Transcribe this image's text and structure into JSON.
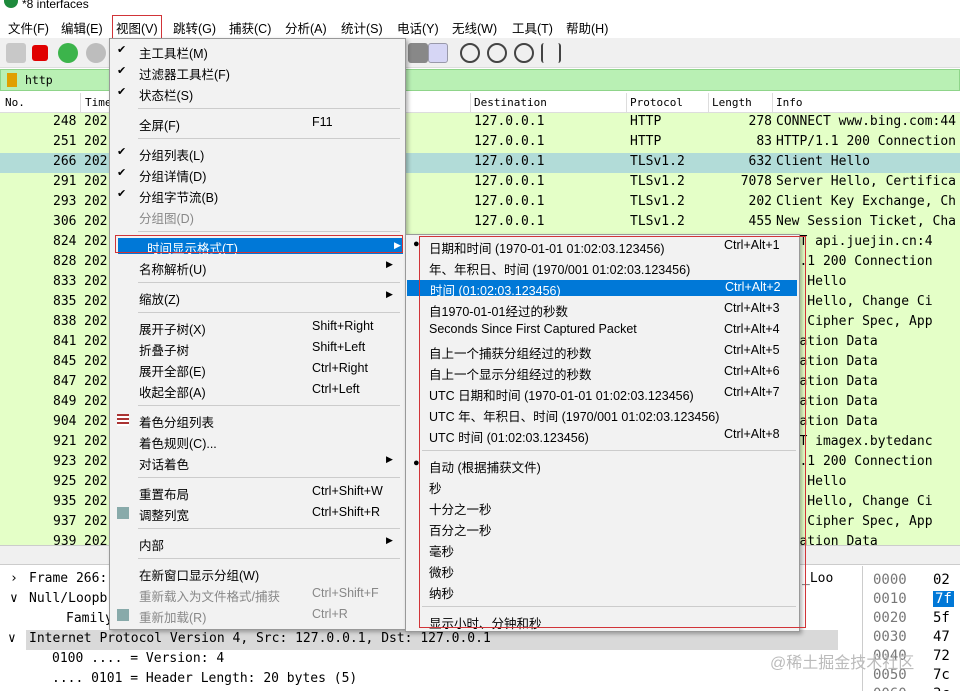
{
  "window": {
    "title": "*8 interfaces"
  },
  "menubar": [
    "文件(F)",
    "编辑(E)",
    "视图(V)",
    "跳转(G)",
    "捕获(C)",
    "分析(A)",
    "统计(S)",
    "电话(Y)",
    "无线(W)",
    "工具(T)",
    "帮助(H)"
  ],
  "filter": {
    "value": "http"
  },
  "columns": [
    "No.",
    "Time",
    "Destination",
    "Protocol",
    "Length",
    "Info"
  ],
  "packets": [
    {
      "no": "248",
      "time": "202",
      "dst": "127.0.0.1",
      "proto": "HTTP",
      "len": "278",
      "info": "CONNECT www.bing.com:44"
    },
    {
      "no": "251",
      "time": "202",
      "dst": "127.0.0.1",
      "proto": "HTTP",
      "len": "83",
      "info": "HTTP/1.1 200 Connection"
    },
    {
      "no": "266",
      "time": "202",
      "dst": "127.0.0.1",
      "proto": "TLSv1.2",
      "len": "632",
      "info": "Client Hello"
    },
    {
      "no": "291",
      "time": "202",
      "dst": "127.0.0.1",
      "proto": "TLSv1.2",
      "len": "7078",
      "info": "Server Hello, Certifica"
    },
    {
      "no": "293",
      "time": "202",
      "dst": "127.0.0.1",
      "proto": "TLSv1.2",
      "len": "202",
      "info": "Client Key Exchange, Ch"
    },
    {
      "no": "306",
      "time": "202",
      "dst": "127.0.0.1",
      "proto": "TLSv1.2",
      "len": "455",
      "info": "New Session Ticket, Cha"
    },
    {
      "no": "824",
      "time": "202",
      "info": "NECT api.juejin.cn:4"
    },
    {
      "no": "828",
      "time": "202",
      "info": "P/1.1 200 Connection"
    },
    {
      "no": "833",
      "time": "202",
      "info": "ent Hello"
    },
    {
      "no": "835",
      "time": "202",
      "info": "ver Hello, Change Ci"
    },
    {
      "no": "838",
      "time": "202",
      "info": "nge Cipher Spec, App"
    },
    {
      "no": "841",
      "time": "202",
      "info": "lication Data"
    },
    {
      "no": "845",
      "time": "202",
      "info": "lication Data"
    },
    {
      "no": "847",
      "time": "202",
      "info": "lication Data"
    },
    {
      "no": "849",
      "time": "202",
      "info": "lication Data"
    },
    {
      "no": "904",
      "time": "202",
      "info": "lication Data"
    },
    {
      "no": "921",
      "time": "202",
      "info": "NECT imagex.bytedanc"
    },
    {
      "no": "923",
      "time": "202",
      "info": "P/1.1 200 Connection"
    },
    {
      "no": "925",
      "time": "202",
      "info": "ent Hello"
    },
    {
      "no": "935",
      "time": "202",
      "info": "ver Hello, Change Ci"
    },
    {
      "no": "937",
      "time": "202",
      "info": "nge Cipher Spec, App"
    },
    {
      "no": "939",
      "time": "202",
      "info": "lication Data"
    }
  ],
  "details": [
    {
      "exp": "›",
      "text": "Frame 266:",
      "extra": "_Loo"
    },
    {
      "exp": "∨",
      "text": "Null/Loopb"
    },
    {
      "exp": "",
      "text": "Family:"
    },
    {
      "exp": "∨",
      "text": "Internet Protocol Version 4, Src: 127.0.0.1, Dst: 127.0.0.1"
    },
    {
      "exp": "",
      "text": "0100 .... = Version: 4"
    },
    {
      "exp": "",
      "text": ".... 0101 = Header Length: 20 bytes (5)"
    }
  ],
  "hex": [
    {
      "off": "0000",
      "b": "02"
    },
    {
      "off": "0010",
      "b": "7f"
    },
    {
      "off": "0020",
      "b": "5f"
    },
    {
      "off": "0030",
      "b": "47"
    },
    {
      "off": "0040",
      "b": "72"
    },
    {
      "off": "0050",
      "b": "7c"
    },
    {
      "off": "0060",
      "b": "3c"
    }
  ],
  "view_menu": [
    {
      "chk": "✔",
      "label": "主工具栏(M)"
    },
    {
      "chk": "✔",
      "label": "过滤器工具栏(F)"
    },
    {
      "chk": "✔",
      "label": "状态栏(S)"
    },
    {
      "sep": true
    },
    {
      "label": "全屏(F)",
      "sc": "F11"
    },
    {
      "sep": true
    },
    {
      "chk": "✔",
      "label": "分组列表(L)"
    },
    {
      "chk": "✔",
      "label": "分组详情(D)"
    },
    {
      "chk": "✔",
      "label": "分组字节流(B)"
    },
    {
      "label": "分组图(D)",
      "dis": true
    },
    {
      "sep": true
    },
    {
      "label": "时间显示格式(T)",
      "arrow": true,
      "hl": true
    },
    {
      "label": "名称解析(U)",
      "arrow": true
    },
    {
      "sep": true
    },
    {
      "label": "缩放(Z)",
      "arrow": true
    },
    {
      "sep": true
    },
    {
      "label": "展开子树(X)",
      "sc": "Shift+Right"
    },
    {
      "label": "折叠子树",
      "sc": "Shift+Left"
    },
    {
      "label": "展开全部(E)",
      "sc": "Ctrl+Right"
    },
    {
      "label": "收起全部(A)",
      "sc": "Ctrl+Left"
    },
    {
      "sep": true
    },
    {
      "label": "着色分组列表",
      "icon": "color"
    },
    {
      "label": "着色规则(C)..."
    },
    {
      "label": "对话着色",
      "arrow": true
    },
    {
      "sep": true
    },
    {
      "label": "重置布局",
      "sc": "Ctrl+Shift+W"
    },
    {
      "label": "调整列宽",
      "sc": "Ctrl+Shift+R",
      "icon": "resize"
    },
    {
      "sep": true
    },
    {
      "label": "内部",
      "arrow": true
    },
    {
      "sep": true
    },
    {
      "label": "在新窗口显示分组(W)"
    },
    {
      "label": "重新载入为文件格式/捕获",
      "sc": "Ctrl+Shift+F",
      "dis": true
    },
    {
      "label": "重新加载(R)",
      "sc": "Ctrl+R",
      "dis": true,
      "icon": "reload"
    }
  ],
  "time_menu": [
    {
      "chk": "●",
      "label": "日期和时间 (1970-01-01 01:02:03.123456)",
      "sc": "Ctrl+Alt+1"
    },
    {
      "label": "年、年积日、时间 (1970/001 01:02:03.123456)"
    },
    {
      "label": "时间 (01:02:03.123456)",
      "sc": "Ctrl+Alt+2",
      "hl": true
    },
    {
      "label": "自1970-01-01经过的秒数",
      "sc": "Ctrl+Alt+3"
    },
    {
      "label": "Seconds Since First Captured Packet",
      "sc": "Ctrl+Alt+4"
    },
    {
      "label": "自上一个捕获分组经过的秒数",
      "sc": "Ctrl+Alt+5"
    },
    {
      "label": "自上一个显示分组经过的秒数",
      "sc": "Ctrl+Alt+6"
    },
    {
      "label": "UTC 日期和时间 (1970-01-01 01:02:03.123456)",
      "sc": "Ctrl+Alt+7"
    },
    {
      "label": "UTC 年、年积日、时间 (1970/001 01:02:03.123456)"
    },
    {
      "label": "UTC 时间 (01:02:03.123456)",
      "sc": "Ctrl+Alt+8"
    },
    {
      "sep": true
    },
    {
      "chk": "●",
      "label": "自动 (根据捕获文件)"
    },
    {
      "label": "秒"
    },
    {
      "label": "十分之一秒"
    },
    {
      "label": "百分之一秒"
    },
    {
      "label": "毫秒"
    },
    {
      "label": "微秒"
    },
    {
      "label": "纳秒"
    },
    {
      "sep": true
    },
    {
      "label": "显示小时、分钟和秒"
    }
  ],
  "watermark": "@稀土掘金技术社区",
  "colors": {
    "packet_bg": "#e4ffc7",
    "selected_row": "#b2dcd8",
    "menu_highlight": "#0078d7",
    "annotation_red": "#d13438",
    "filter_bg": "#b9f0b4"
  }
}
